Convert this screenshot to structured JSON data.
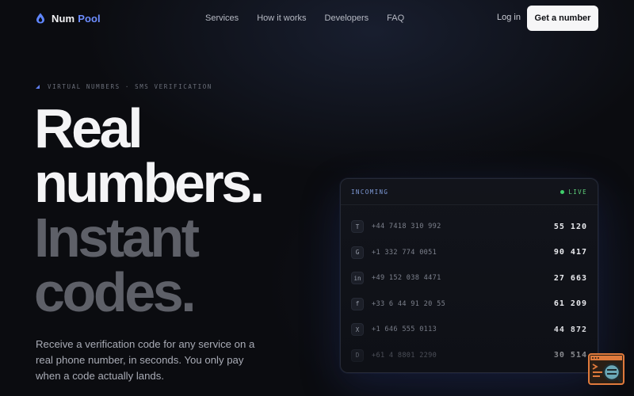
{
  "brand": {
    "name_part1": "Num",
    "name_part2": "Pool",
    "icon": "drop-icon"
  },
  "nav": {
    "links": [
      "Services",
      "How it works",
      "Developers",
      "FAQ"
    ],
    "login": "Log in",
    "cta": "Get a number"
  },
  "hero": {
    "eyebrow": "VIRTUAL NUMBERS · SMS VERIFICATION",
    "headline": [
      "Real",
      "numbers.",
      "Instant",
      "codes."
    ],
    "subtitle": "Receive a verification code for any service on a real phone number, in seconds. You only pay when a code actually lands."
  },
  "panel": {
    "title": "INCOMING",
    "status": "LIVE",
    "rows": [
      {
        "service": "T",
        "number": "+44 7418 310 992",
        "code": "55 120"
      },
      {
        "service": "G",
        "number": "+1 332 774 0051",
        "code": "90 417"
      },
      {
        "service": "in",
        "number": "+49 152 038 4471",
        "code": "27 663"
      },
      {
        "service": "f",
        "number": "+33 6 44 91 20 55",
        "code": "61 209"
      },
      {
        "service": "X",
        "number": "+1 646 555 0113",
        "code": "44 872"
      },
      {
        "service": "D",
        "number": "+61 4 8801 2290",
        "code": "30 514"
      }
    ]
  },
  "colors": {
    "background": "#0b0c10",
    "accent": "#6d8dff",
    "live": "#3fcf6b",
    "cta_bg": "#f6f6f7"
  }
}
